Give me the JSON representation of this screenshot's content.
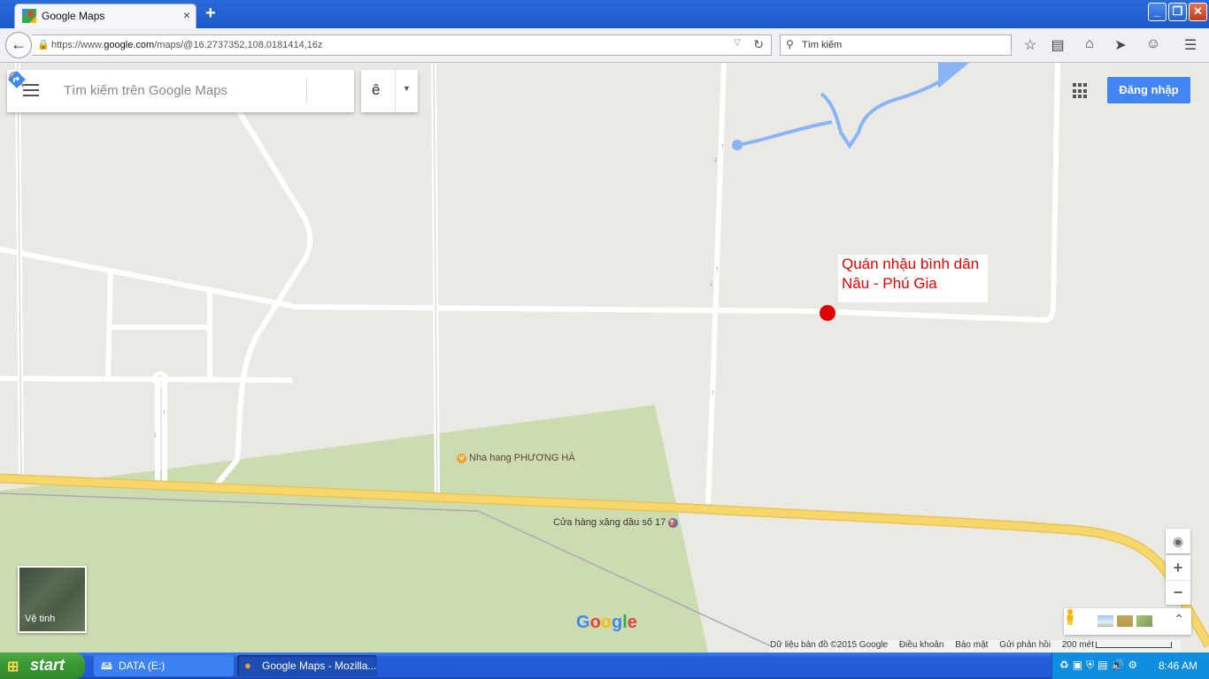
{
  "browser": {
    "tab_title": "Google Maps",
    "tab_close": "×",
    "new_tab": "+",
    "url_prefix": "https://www.",
    "url_host": "google.com",
    "url_path": "/maps/@16.2737352,108.0181414,16z",
    "search_placeholder": "Tìm kiếm",
    "window_buttons": {
      "minimize": "_",
      "maximize": "❐",
      "close": "✕"
    }
  },
  "maps": {
    "search_placeholder": "Tìm kiếm trên Google Maps",
    "language_btn": "ê",
    "signin_label": "Đăng nhập",
    "annotation_text": "Quán nhậu bình dân Nâu - Phú Gia",
    "poi": {
      "restaurant": "Nha hang PHƯƠNG HÀ",
      "gas_station": "Cửa hàng xăng dầu số 17"
    },
    "satellite_label": "Vệ tinh",
    "logo": "Google",
    "footer": {
      "data": "Dữ liệu bản đồ ©2015 Google",
      "terms": "Điều khoản",
      "privacy": "Bảo mật",
      "feedback": "Gửi phản hồi",
      "scale": "200 mét"
    },
    "zoom_in": "+",
    "zoom_out": "−",
    "colors": {
      "land": "#ebe9e4",
      "park": "#cddcb0",
      "highway": "#f7d66a",
      "water": "#8ab4f8",
      "accent": "#4285f4",
      "annotation": "#e00000"
    }
  },
  "taskbar": {
    "start_label": "start",
    "items": [
      {
        "label": "DATA (E:)"
      },
      {
        "label": "Google Maps - Mozilla..."
      }
    ],
    "clock": "8:46 AM"
  }
}
